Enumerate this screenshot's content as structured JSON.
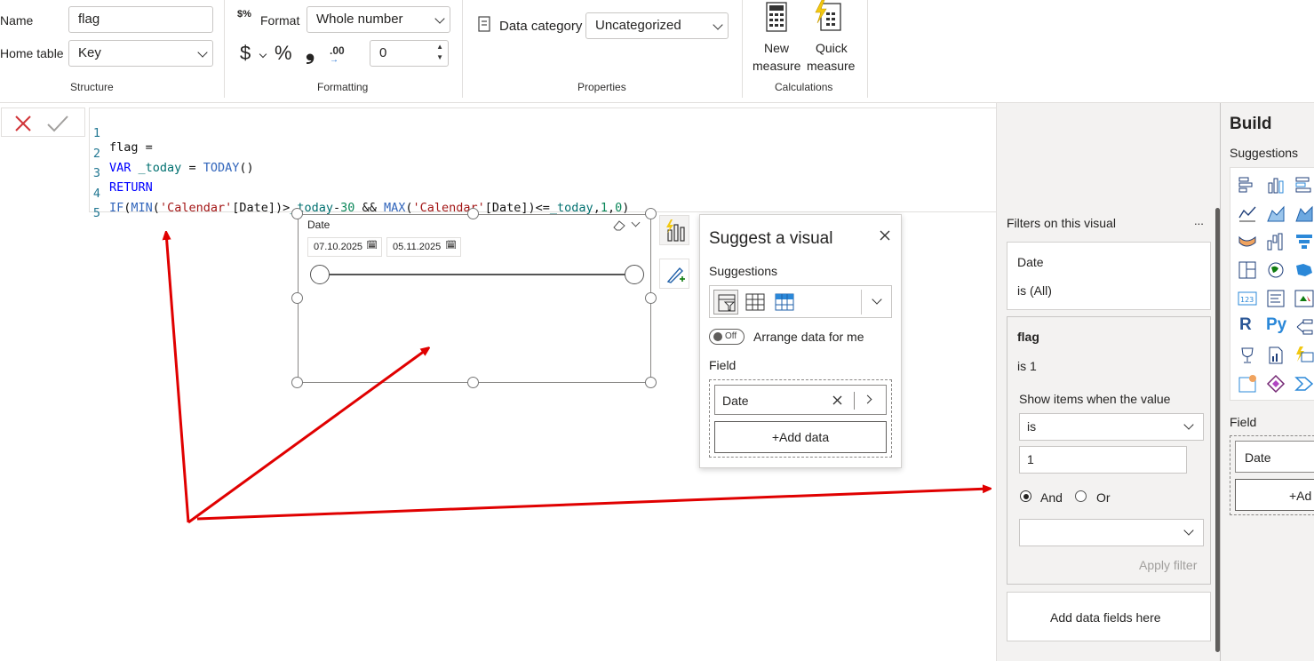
{
  "ribbon": {
    "structure": {
      "name_label": "Name",
      "name_value": "flag",
      "home_table_label": "Home table",
      "home_table_value": "Key",
      "group_label": "Structure"
    },
    "formatting": {
      "format_label": "Format",
      "format_value": "Whole number",
      "currency_symbol": "$",
      "percent_symbol": "%",
      "comma_symbol": "̹",
      "decimal_symbol": ".00",
      "decimals_value": "0",
      "group_label": "Formatting"
    },
    "properties": {
      "data_category_label": "Data category",
      "data_category_value": "Uncategorized",
      "group_label": "Properties"
    },
    "calculations": {
      "new_measure_line1": "New",
      "new_measure_line2": "measure",
      "quick_measure_line1": "Quick",
      "quick_measure_line2": "measure",
      "group_label": "Calculations"
    }
  },
  "formula": {
    "lines": [
      {
        "num": "1",
        "text": "flag ="
      },
      {
        "num": "2",
        "text": "VAR _today = TODAY()"
      },
      {
        "num": "3",
        "text": "RETURN"
      },
      {
        "num": "4",
        "text": "IF(MIN('Calendar'[Date])>_today-30 && MAX('Calendar'[Date])<=_today,1,0)"
      },
      {
        "num": "5",
        "text": ""
      }
    ]
  },
  "slicer": {
    "title": "Date",
    "start_date": "07.10.2025",
    "end_date": "05.11.2025"
  },
  "suggest_visual": {
    "title": "Suggest a visual",
    "suggestions_label": "Suggestions",
    "toggle_label": "Off",
    "arrange_label": "Arrange data for me",
    "field_label": "Field",
    "field_value": "Date",
    "add_data_label": "+Add data"
  },
  "filters": {
    "header": "Filters on this visual",
    "more": "...",
    "date_card": {
      "title": "Date",
      "state": "is (All)"
    },
    "flag_card": {
      "title": "flag",
      "state": "is 1",
      "show_items_label": "Show items when the value",
      "condition": "is",
      "value": "1",
      "and_label": "And",
      "or_label": "Or",
      "apply_label": "Apply filter"
    },
    "add_fields_label": "Add data fields here"
  },
  "build": {
    "title": "Build",
    "suggestions_label": "Suggestions",
    "field_label": "Field",
    "field_value": "Date",
    "add_label": "+Ad"
  },
  "colors": {
    "accent_red": "#e81123",
    "annotation_arrow": "#e00000",
    "pane_bg": "#f3f2f1"
  }
}
